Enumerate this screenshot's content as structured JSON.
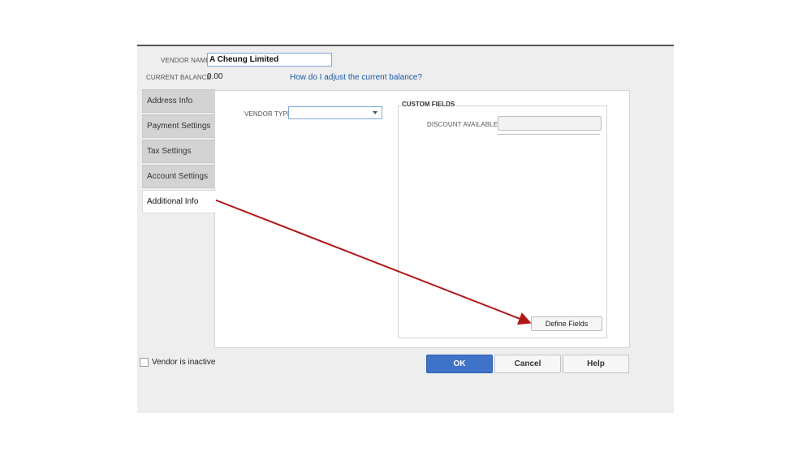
{
  "vendor": {
    "name_label": "VENDOR NAME",
    "name_value": "A Cheung Limited",
    "balance_label": "CURRENT BALANCE",
    "balance_value": "0.00",
    "balance_help_link": "How do I adjust the current balance?"
  },
  "tabs": [
    {
      "label": "Address Info"
    },
    {
      "label": "Payment Settings"
    },
    {
      "label": "Tax Settings"
    },
    {
      "label": "Account Settings"
    },
    {
      "label": "Additional Info"
    }
  ],
  "additional_info": {
    "vendor_type_label": "VENDOR TYPE",
    "vendor_type_value": "",
    "custom_fields_title": "CUSTOM FIELDS",
    "discount_label": "DISCOUNT AVAILABLE",
    "discount_value": "",
    "define_fields_label": "Define Fields"
  },
  "footer": {
    "inactive_label": "Vendor is inactive",
    "inactive_checked": false,
    "ok_label": "OK",
    "cancel_label": "Cancel",
    "help_label": "Help"
  },
  "colors": {
    "arrow": "#b01919",
    "ok_button": "#3f72c9",
    "link": "#1a5aa8"
  }
}
